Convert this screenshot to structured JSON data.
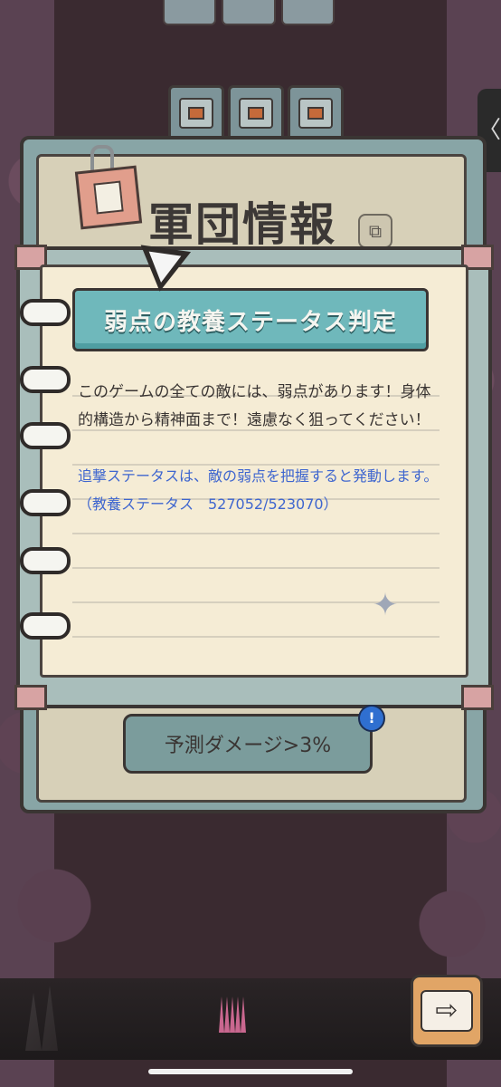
{
  "header": {
    "title": "軍団情報"
  },
  "notebook": {
    "ribbon_title": "弱点の教養ステータス判定",
    "description": "このゲームの全ての敵には、弱点があります！身体的構造から精神面まで！遠慮なく狙ってください！",
    "highlight": "追撃ステータスは、敵の弱点を把握すると発動します。（教養ステータス　527052/523070）"
  },
  "footer": {
    "damage_button": "予測ダメージ>3%",
    "info_label": "!",
    "next_icon": "arrow-right-icon"
  },
  "side": {
    "tab_icon": "chevron-left-icon",
    "tab_label": "〈"
  },
  "colors": {
    "accent_teal": "#6fb8bb",
    "text_blue": "#3f66cf",
    "next_orange": "#e1a566"
  }
}
